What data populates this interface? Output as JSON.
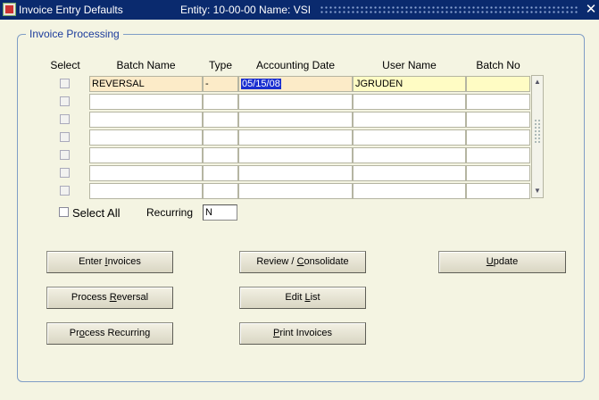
{
  "window": {
    "title": "Invoice Entry Defaults",
    "entity_info": "Entity: 10-00-00  Name: VSI",
    "close_icon": "close-icon"
  },
  "group": {
    "label": "Invoice Processing"
  },
  "columns": {
    "select": "Select",
    "batch_name": "Batch Name",
    "type": "Type",
    "accounting_date": "Accounting Date",
    "user_name": "User Name",
    "batch_no": "Batch No"
  },
  "rows": [
    {
      "batch_name": "REVERSAL",
      "type": "-",
      "accounting_date": "05/15/08",
      "user_name": "JGRUDEN",
      "batch_no": ""
    },
    {
      "batch_name": "",
      "type": "",
      "accounting_date": "",
      "user_name": "",
      "batch_no": ""
    },
    {
      "batch_name": "",
      "type": "",
      "accounting_date": "",
      "user_name": "",
      "batch_no": ""
    },
    {
      "batch_name": "",
      "type": "",
      "accounting_date": "",
      "user_name": "",
      "batch_no": ""
    },
    {
      "batch_name": "",
      "type": "",
      "accounting_date": "",
      "user_name": "",
      "batch_no": ""
    },
    {
      "batch_name": "",
      "type": "",
      "accounting_date": "",
      "user_name": "",
      "batch_no": ""
    },
    {
      "batch_name": "",
      "type": "",
      "accounting_date": "",
      "user_name": "",
      "batch_no": ""
    }
  ],
  "select_all": {
    "label": "Select All"
  },
  "recurring": {
    "label": "Recurring",
    "value": "N"
  },
  "buttons": {
    "enter_invoices": {
      "pre": "Enter ",
      "acc": "I",
      "post": "nvoices"
    },
    "review_consolidate": {
      "pre": "Review / ",
      "acc": "C",
      "post": "onsolidate"
    },
    "update": {
      "pre": "",
      "acc": "U",
      "post": "pdate"
    },
    "process_reversal": {
      "pre": "Process ",
      "acc": "R",
      "post": "eversal"
    },
    "edit_list": {
      "pre": "Edit ",
      "acc": "L",
      "post": "ist"
    },
    "process_recurring": {
      "pre": "Pr",
      "acc": "o",
      "post": "cess Recurring"
    },
    "print_invoices": {
      "pre": "",
      "acc": "P",
      "post": "rint Invoices"
    }
  }
}
